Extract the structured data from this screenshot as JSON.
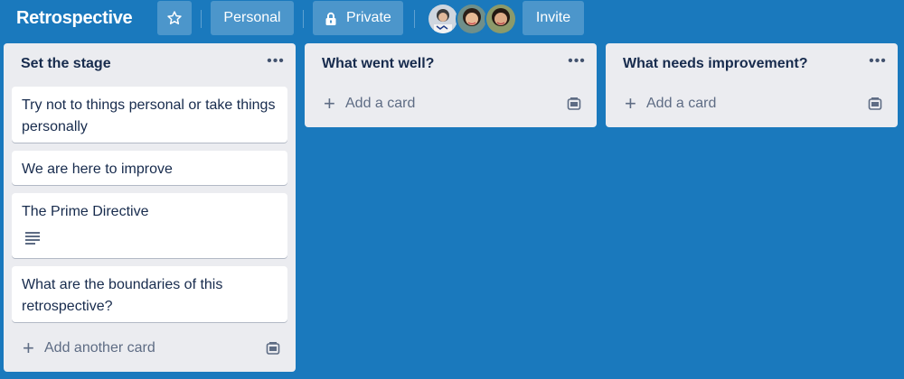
{
  "header": {
    "title": "Retrospective",
    "personal_label": "Personal",
    "private_label": "Private",
    "invite_label": "Invite",
    "star_icon": "star-icon",
    "lock_icon": "lock-icon",
    "members": [
      "avatar-1",
      "avatar-2",
      "avatar-3"
    ]
  },
  "lists": [
    {
      "title": "Set the stage",
      "cards": [
        {
          "text": "Try not to things personal or take things personally"
        },
        {
          "text": "We are here to improve"
        },
        {
          "text": "The Prime Directive",
          "has_description": true
        },
        {
          "text": "What are the boundaries of this retrospective?"
        }
      ],
      "add_label": "Add another card"
    },
    {
      "title": "What went well?",
      "cards": [],
      "add_label": "Add a card"
    },
    {
      "title": "What needs improvement?",
      "cards": [],
      "add_label": "Add a card"
    }
  ],
  "colors": {
    "board_background": "#1a79bd",
    "list_background": "#ebecf0",
    "card_background": "#ffffff",
    "text": "#172b4d"
  }
}
